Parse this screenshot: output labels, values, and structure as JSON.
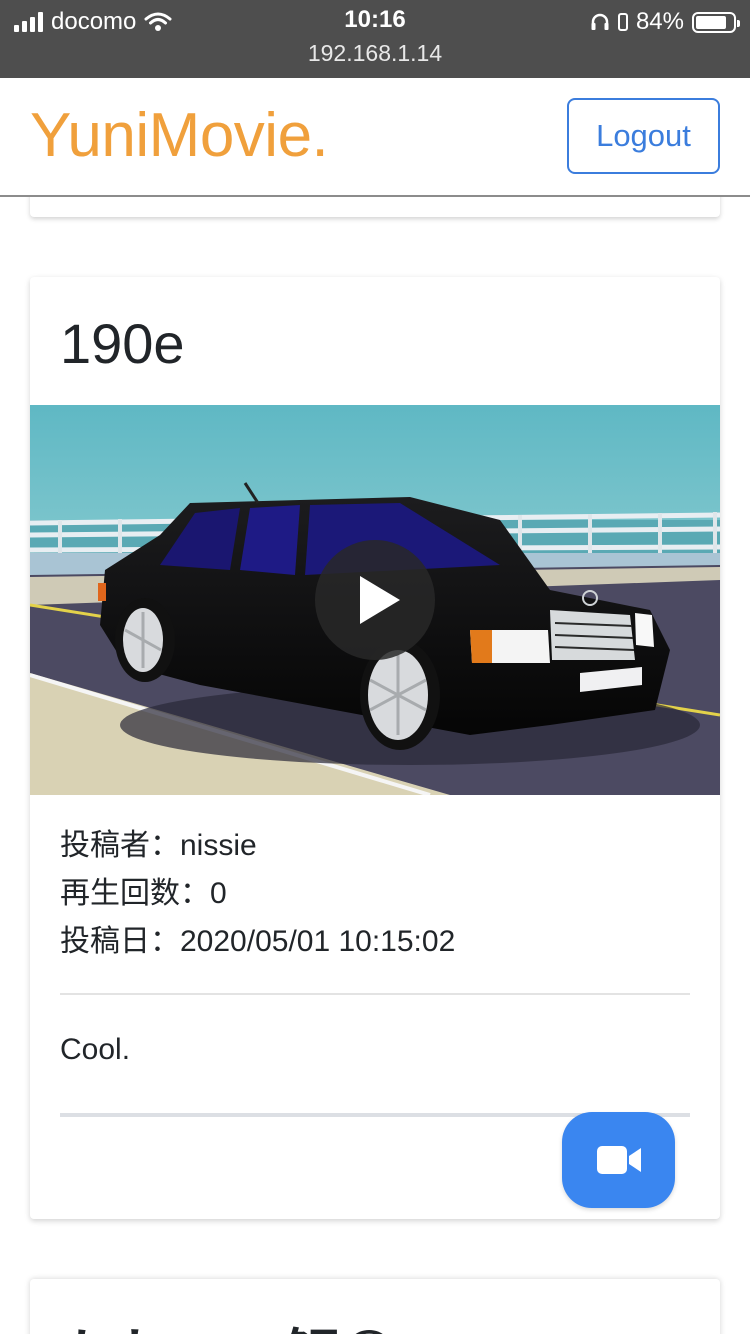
{
  "status_bar": {
    "carrier": "docomo",
    "time": "10:16",
    "url": "192.168.1.14",
    "battery": "84%",
    "battery_level": 0.84
  },
  "navbar": {
    "brand": "YuniMovie.",
    "logout_label": "Logout"
  },
  "post": {
    "title": "190e",
    "poster_label": "投稿者：",
    "poster": "nissie",
    "views_label": "再生回数：",
    "views": "0",
    "date_label": "投稿日：",
    "date": "2020/05/01 10:15:02",
    "comment": "Cool."
  },
  "next_post": {
    "title": "かわいい鯉😳🐟"
  },
  "icons": {
    "play": "play-icon",
    "fab": "video-camera-icon",
    "wifi": "wifi-icon",
    "headphones": "headphones-icon",
    "battery": "battery-icon"
  },
  "colors": {
    "brand": "#f0a03c",
    "primary": "#3b7ddd",
    "fab": "#3a86f0",
    "status_bar": "#4e4e4e"
  }
}
